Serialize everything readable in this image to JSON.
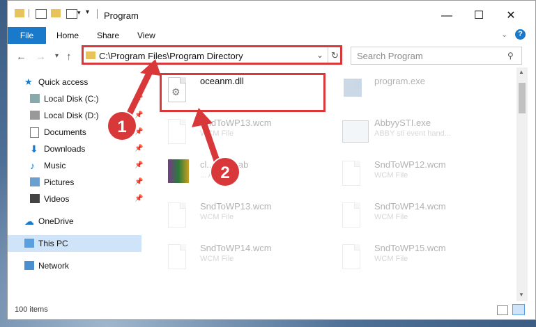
{
  "window": {
    "title": "Program",
    "controls": {
      "minimize": "—",
      "maximize": "☐",
      "close": "✕"
    }
  },
  "ribbon": {
    "tabs": [
      "File",
      "Home",
      "Share",
      "View"
    ],
    "help": "?"
  },
  "nav": {
    "address": "C:\\Program Files\\Program Directory",
    "search_placeholder": "Search Program"
  },
  "sidebar": {
    "items": [
      {
        "label": "Quick access",
        "icon": "star-icon"
      },
      {
        "label": "Local Disk (C:)",
        "icon": "drive-icon"
      },
      {
        "label": "Local Disk (D:)",
        "icon": "drive-icon"
      },
      {
        "label": "Documents",
        "icon": "documents-icon"
      },
      {
        "label": "Downloads",
        "icon": "downloads-icon"
      },
      {
        "label": "Music",
        "icon": "music-icon"
      },
      {
        "label": "Pictures",
        "icon": "pictures-icon"
      },
      {
        "label": "Videos",
        "icon": "videos-icon"
      },
      {
        "label": "OneDrive",
        "icon": "cloud-icon"
      },
      {
        "label": "This PC",
        "icon": "computer-icon"
      },
      {
        "label": "Network",
        "icon": "network-icon"
      }
    ]
  },
  "files": [
    {
      "name": "oceanm.dll",
      "type": ""
    },
    {
      "name": "program.exe",
      "type": ""
    },
    {
      "name": "SndToWP13.wcm",
      "type": "WCM File"
    },
    {
      "name": "AbbyySTI.exe",
      "type": "ABBY sti event hand..."
    },
    {
      "name": "cl...ates.cab",
      "type": "... Archive"
    },
    {
      "name": "SndToWP12.wcm",
      "type": "WCM File"
    },
    {
      "name": "SndToWP13.wcm",
      "type": "WCM File"
    },
    {
      "name": "SndToWP14.wcm",
      "type": "WCM File"
    },
    {
      "name": "SndToWP14.wcm",
      "type": "WCM File"
    },
    {
      "name": "SndToWP15.wcm",
      "type": "WCM File"
    }
  ],
  "status": {
    "item_count": "100 items"
  },
  "annotations": {
    "step1": "1",
    "step2": "2",
    "color": "#d9383a"
  }
}
